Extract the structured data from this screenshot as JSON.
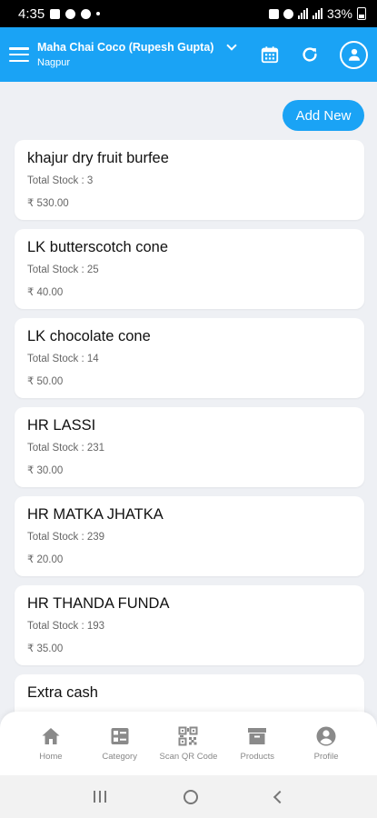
{
  "status_bar": {
    "time": "4:35",
    "battery": "33%"
  },
  "header": {
    "store_name": "Maha Chai Coco (Rupesh Gupta)",
    "city": "Nagpur"
  },
  "add_new_label": "Add New",
  "products": [
    {
      "name": "khajur dry fruit burfee",
      "stock": "Total Stock : 3",
      "price": "₹ 530.00"
    },
    {
      "name": "LK butterscotch cone",
      "stock": "Total Stock : 25",
      "price": "₹ 40.00"
    },
    {
      "name": "LK chocolate cone",
      "stock": "Total Stock : 14",
      "price": "₹ 50.00"
    },
    {
      "name": "HR LASSI",
      "stock": "Total Stock : 231",
      "price": "₹ 30.00"
    },
    {
      "name": "HR MATKA JHATKA",
      "stock": "Total Stock : 239",
      "price": "₹ 20.00"
    },
    {
      "name": "HR THANDA FUNDA",
      "stock": "Total Stock : 193",
      "price": "₹ 35.00"
    },
    {
      "name": "Extra cash",
      "stock": "",
      "price": ""
    }
  ],
  "bottom_nav": [
    {
      "label": "Home",
      "icon": "home-icon"
    },
    {
      "label": "Category",
      "icon": "category-icon"
    },
    {
      "label": "Scan QR Code",
      "icon": "qr-code-icon"
    },
    {
      "label": "Products",
      "icon": "products-icon"
    },
    {
      "label": "Profile",
      "icon": "profile-icon"
    }
  ],
  "colors": {
    "primary": "#1aa3f5",
    "background": "#eef0f4",
    "nav_icon": "#8a8a8a"
  }
}
